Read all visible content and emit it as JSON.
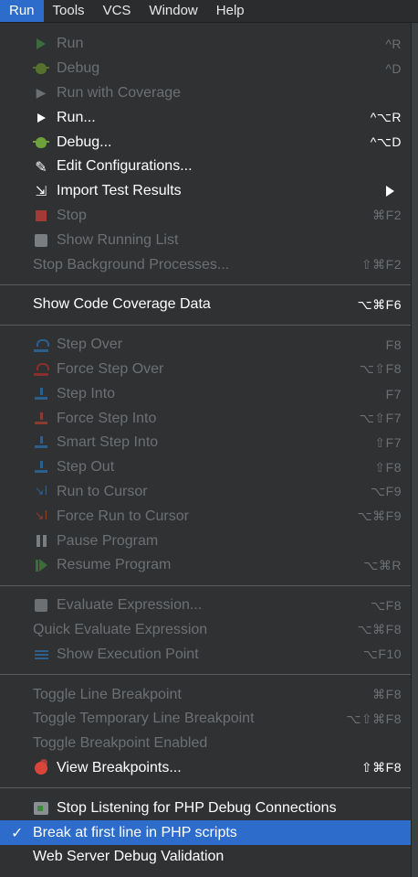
{
  "menubar": {
    "items": [
      "Run",
      "Tools",
      "VCS",
      "Window",
      "Help"
    ],
    "active_index": 0
  },
  "colors": {
    "panel_bg": "#2f3133",
    "selection": "#2d6ccb",
    "disabled_text": "#6d7073",
    "text": "#ffffff"
  },
  "menu": {
    "group1": [
      {
        "label": "Run",
        "shortcut": "^R",
        "enabled": false,
        "icon": "run-icon"
      },
      {
        "label": "Debug",
        "shortcut": "^D",
        "enabled": false,
        "icon": "debug-icon"
      },
      {
        "label": "Run with Coverage",
        "shortcut": "",
        "enabled": false,
        "icon": "coverage-icon"
      },
      {
        "label": "Run...",
        "shortcut": "^⌥R",
        "enabled": true,
        "icon": "run-icon"
      },
      {
        "label": "Debug...",
        "shortcut": "^⌥D",
        "enabled": true,
        "icon": "debug-icon"
      },
      {
        "label": "Edit Configurations...",
        "shortcut": "",
        "enabled": true,
        "icon": "edit-icon"
      },
      {
        "label": "Import Test Results",
        "shortcut": "",
        "enabled": true,
        "icon": "import-icon",
        "submenu": true
      },
      {
        "label": "Stop",
        "shortcut": "⌘F2",
        "enabled": false,
        "icon": "stop-icon"
      },
      {
        "label": "Show Running List",
        "shortcut": "",
        "enabled": false,
        "icon": "list-icon"
      },
      {
        "label": "Stop Background Processes...",
        "shortcut": "⇧⌘F2",
        "enabled": false
      }
    ],
    "group2": [
      {
        "label": "Show Code Coverage Data",
        "shortcut": "⌥⌘F6",
        "enabled": true
      }
    ],
    "group3": [
      {
        "label": "Step Over",
        "shortcut": "F8",
        "enabled": false,
        "icon": "step-over-icon"
      },
      {
        "label": "Force Step Over",
        "shortcut": "⌥⇧F8",
        "enabled": false,
        "icon": "force-step-over-icon"
      },
      {
        "label": "Step Into",
        "shortcut": "F7",
        "enabled": false,
        "icon": "step-into-icon"
      },
      {
        "label": "Force Step Into",
        "shortcut": "⌥⇧F7",
        "enabled": false,
        "icon": "force-step-into-icon"
      },
      {
        "label": "Smart Step Into",
        "shortcut": "⇧F7",
        "enabled": false,
        "icon": "smart-step-into-icon"
      },
      {
        "label": "Step Out",
        "shortcut": "⇧F8",
        "enabled": false,
        "icon": "step-out-icon"
      },
      {
        "label": "Run to Cursor",
        "shortcut": "⌥F9",
        "enabled": false,
        "icon": "run-to-cursor-icon"
      },
      {
        "label": "Force Run to Cursor",
        "shortcut": "⌥⌘F9",
        "enabled": false,
        "icon": "force-run-to-cursor-icon"
      },
      {
        "label": "Pause Program",
        "shortcut": "",
        "enabled": false,
        "icon": "pause-icon"
      },
      {
        "label": "Resume Program",
        "shortcut": "⌥⌘R",
        "enabled": false,
        "icon": "resume-icon"
      }
    ],
    "group4": [
      {
        "label": "Evaluate Expression...",
        "shortcut": "⌥F8",
        "enabled": false,
        "icon": "calculator-icon"
      },
      {
        "label": "Quick Evaluate Expression",
        "shortcut": "⌥⌘F8",
        "enabled": false
      },
      {
        "label": "Show Execution Point",
        "shortcut": "⌥F10",
        "enabled": false,
        "icon": "execution-point-icon"
      }
    ],
    "group5": [
      {
        "label": "Toggle Line Breakpoint",
        "shortcut": "⌘F8",
        "enabled": false
      },
      {
        "label": "Toggle Temporary Line Breakpoint",
        "shortcut": "⌥⇧⌘F8",
        "enabled": false
      },
      {
        "label": "Toggle Breakpoint Enabled",
        "shortcut": "",
        "enabled": false
      },
      {
        "label": "View Breakpoints...",
        "shortcut": "⇧⌘F8",
        "enabled": true,
        "icon": "breakpoints-icon"
      }
    ],
    "group6": [
      {
        "label": "Stop Listening for PHP Debug Connections",
        "shortcut": "",
        "enabled": true,
        "icon": "php-debug-icon"
      },
      {
        "label": "Break at first line in PHP scripts",
        "shortcut": "",
        "enabled": true,
        "checked": true,
        "selected": true
      },
      {
        "label": "Web Server Debug Validation",
        "shortcut": "",
        "enabled": true
      }
    ]
  }
}
